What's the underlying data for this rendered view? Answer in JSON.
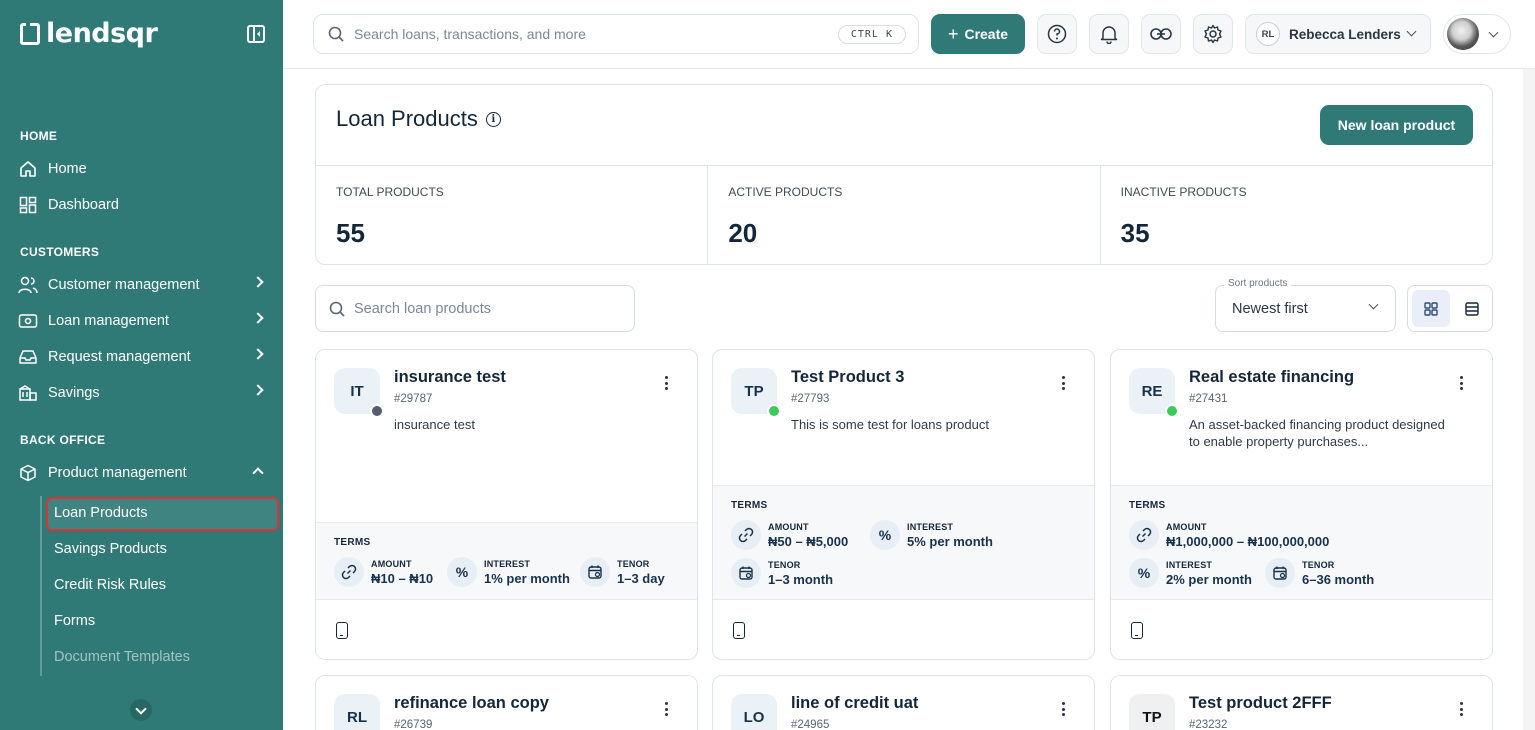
{
  "brand": {
    "name": "lendsqr"
  },
  "sidebar": {
    "sections": [
      {
        "title": "HOME"
      },
      {
        "title": "CUSTOMERS"
      },
      {
        "title": "BACK OFFICE"
      }
    ],
    "items": {
      "home": "Home",
      "dashboard": "Dashboard",
      "customer_management": "Customer management",
      "loan_management": "Loan management",
      "request_management": "Request management",
      "savings": "Savings",
      "product_management": "Product management"
    },
    "sub_items": [
      "Loan Products",
      "Savings Products",
      "Credit Risk Rules",
      "Forms",
      "Document Templates"
    ]
  },
  "topbar": {
    "search_placeholder": "Search loans, transactions, and more",
    "shortcut": "CTRL K",
    "create_label": "Create",
    "user_initials": "RL",
    "user_name": "Rebecca Lenders"
  },
  "page": {
    "title": "Loan Products",
    "new_button": "New loan product",
    "stats": [
      {
        "label": "TOTAL PRODUCTS",
        "value": "55"
      },
      {
        "label": "ACTIVE PRODUCTS",
        "value": "20"
      },
      {
        "label": "INACTIVE PRODUCTS",
        "value": "35"
      }
    ],
    "search_placeholder": "Search loan products",
    "sort_label": "Sort products",
    "sort_value": "Newest first"
  },
  "terms_label": "TERMS",
  "term_keys": {
    "amount": "AMOUNT",
    "interest": "INTEREST",
    "tenor": "TENOR"
  },
  "products": [
    {
      "initials": "IT",
      "name": "insurance test",
      "id": "#29787",
      "description": "insurance test",
      "status": "inactive",
      "amount": "₦10 – ₦10",
      "interest": "1% per month",
      "tenor": "1–3 day"
    },
    {
      "initials": "TP",
      "name": "Test Product 3",
      "id": "#27793",
      "description": "This is some test for loans product",
      "status": "active",
      "amount": "₦50 – ₦5,000",
      "interest": "5% per month",
      "tenor": "1–3 month"
    },
    {
      "initials": "RE",
      "name": "Real estate financing",
      "id": "#27431",
      "description": "An asset-backed financing product designed to enable property purchases...",
      "status": "active",
      "amount": "₦1,000,000 – ₦100,000,000",
      "interest": "2% per month",
      "tenor": "6–36 month"
    },
    {
      "initials": "RL",
      "name": "refinance loan copy",
      "id": "#26739",
      "status": "active"
    },
    {
      "initials": "LO",
      "name": "line of credit uat",
      "id": "#24965",
      "status": "active"
    },
    {
      "initials": "TP",
      "name": "Test product 2FFF",
      "id": "#23232",
      "status": "inactive"
    }
  ],
  "colors": {
    "brand": "#2f7a76",
    "active": "#3ec95c",
    "inactive": "#555e6e",
    "highlight": "#d33333"
  }
}
